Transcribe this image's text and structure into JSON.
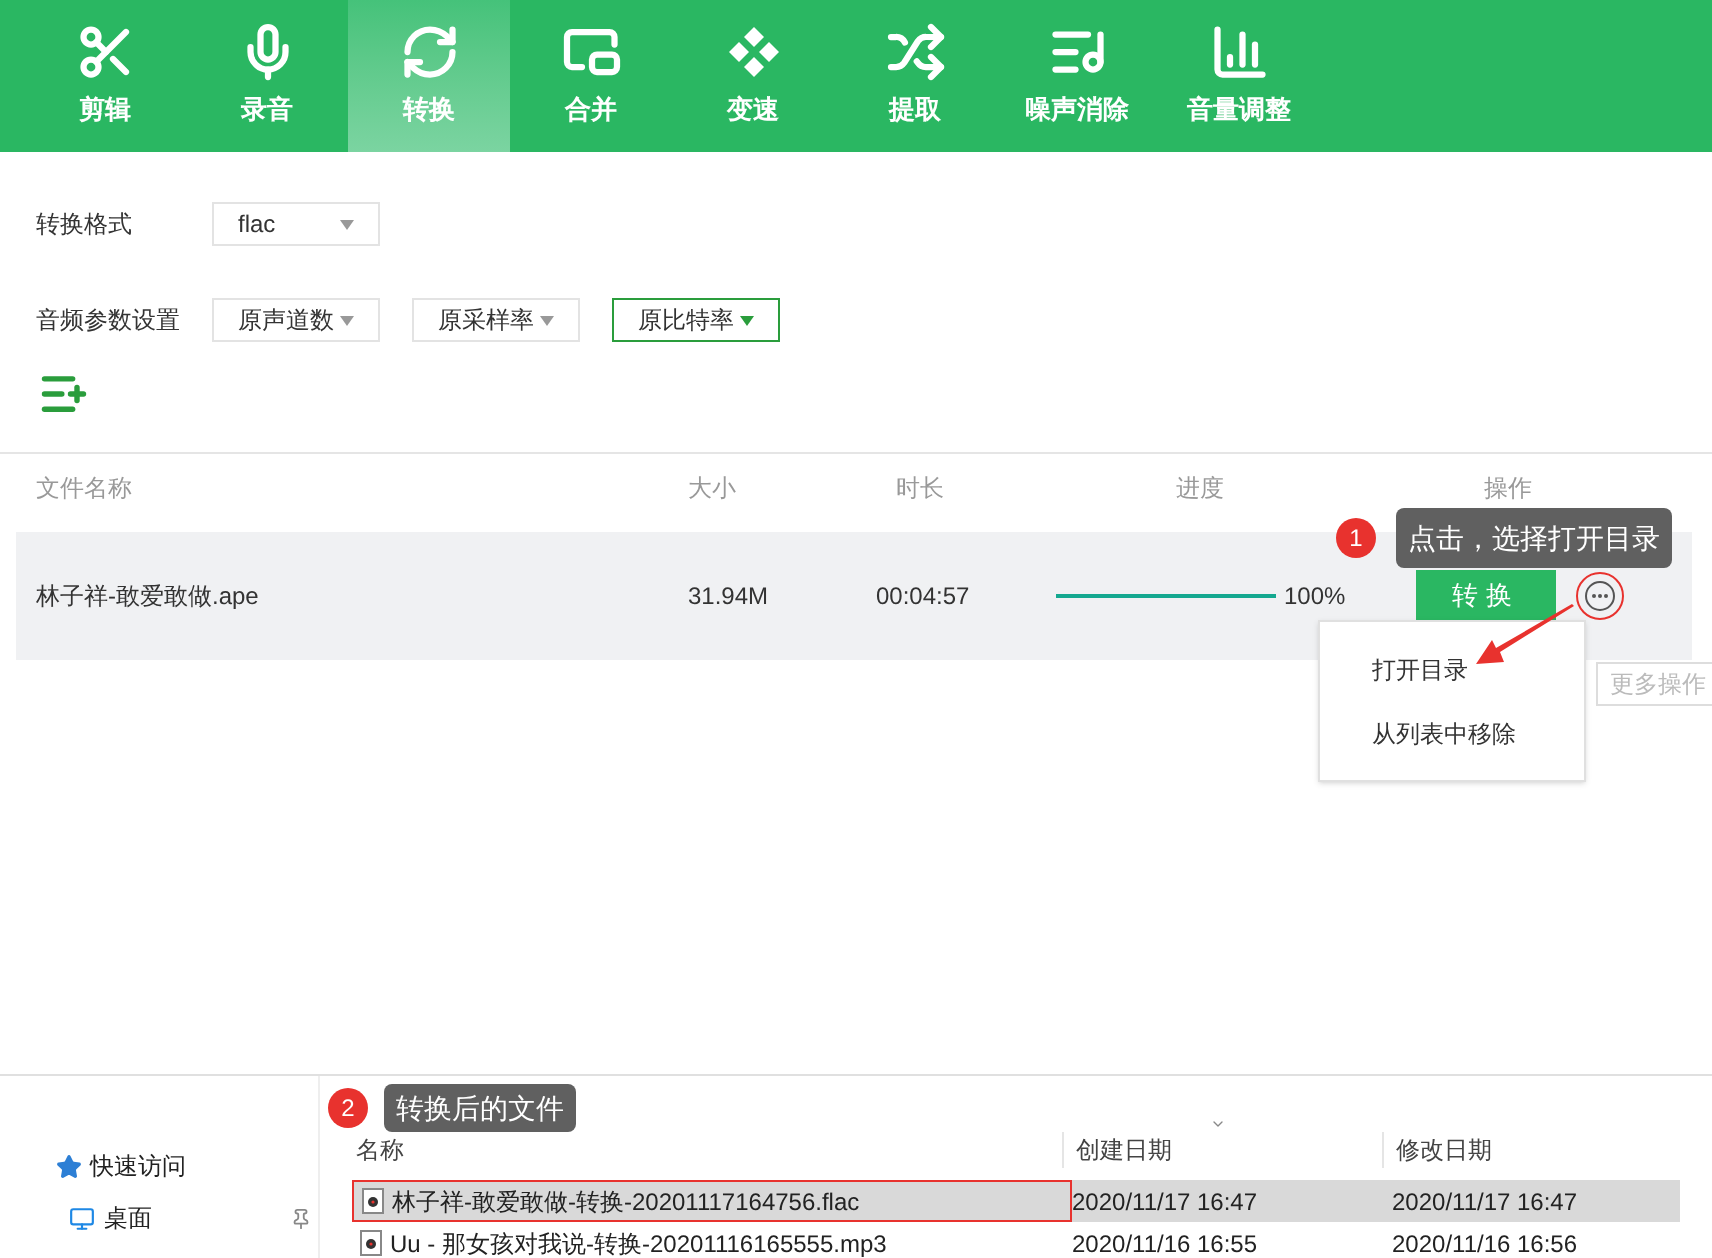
{
  "toolbar": {
    "tabs": [
      {
        "label": "剪辑",
        "selected": false
      },
      {
        "label": "录音",
        "selected": false
      },
      {
        "label": "转换",
        "selected": true
      },
      {
        "label": "合并",
        "selected": false
      },
      {
        "label": "变速",
        "selected": false
      },
      {
        "label": "提取",
        "selected": false
      },
      {
        "label": "噪声消除",
        "selected": false
      },
      {
        "label": "音量调整",
        "selected": false
      }
    ]
  },
  "settings": {
    "format": {
      "label": "转换格式",
      "value": "flac"
    },
    "audio": {
      "label": "音频参数设置",
      "selects": [
        {
          "value": "原声道数",
          "selected": false
        },
        {
          "value": "原采样率",
          "selected": false
        },
        {
          "value": "原比特率",
          "selected": true
        }
      ]
    }
  },
  "table": {
    "columns": [
      "文件名称",
      "大小",
      "时长",
      "进度",
      "操作"
    ],
    "rows": [
      {
        "name": "林子祥-敢爱敢做.ape",
        "size": "31.94M",
        "duration": "00:04:57",
        "level": 1,
        "progress": "100%",
        "action": "转换"
      }
    ]
  },
  "menu": {
    "items": [
      "打开目录",
      "从列表中移除"
    ],
    "tooltip": "更多操作"
  },
  "callouts": [
    {
      "number": "1",
      "text": "点击，选择打开目录"
    },
    {
      "number": "2",
      "text": "转换后的文件"
    }
  ],
  "explorer": {
    "nav": [
      {
        "label": "快速访问"
      },
      {
        "label": "桌面"
      }
    ],
    "columns": [
      "名称",
      "创建日期",
      "修改日期"
    ],
    "files": [
      {
        "name": "林子祥-敢爱敢做-转换-20201117164756.flac",
        "created": "2020/11/17 16:47",
        "modified": "2020/11/17 16:47",
        "selected": true
      },
      {
        "name": "Uu - 那女孩对我说-转换-20201116165555.mp3",
        "created": "2020/11/16 16:55",
        "modified": "2020/11/16 16:56",
        "selected": false
      }
    ]
  }
}
